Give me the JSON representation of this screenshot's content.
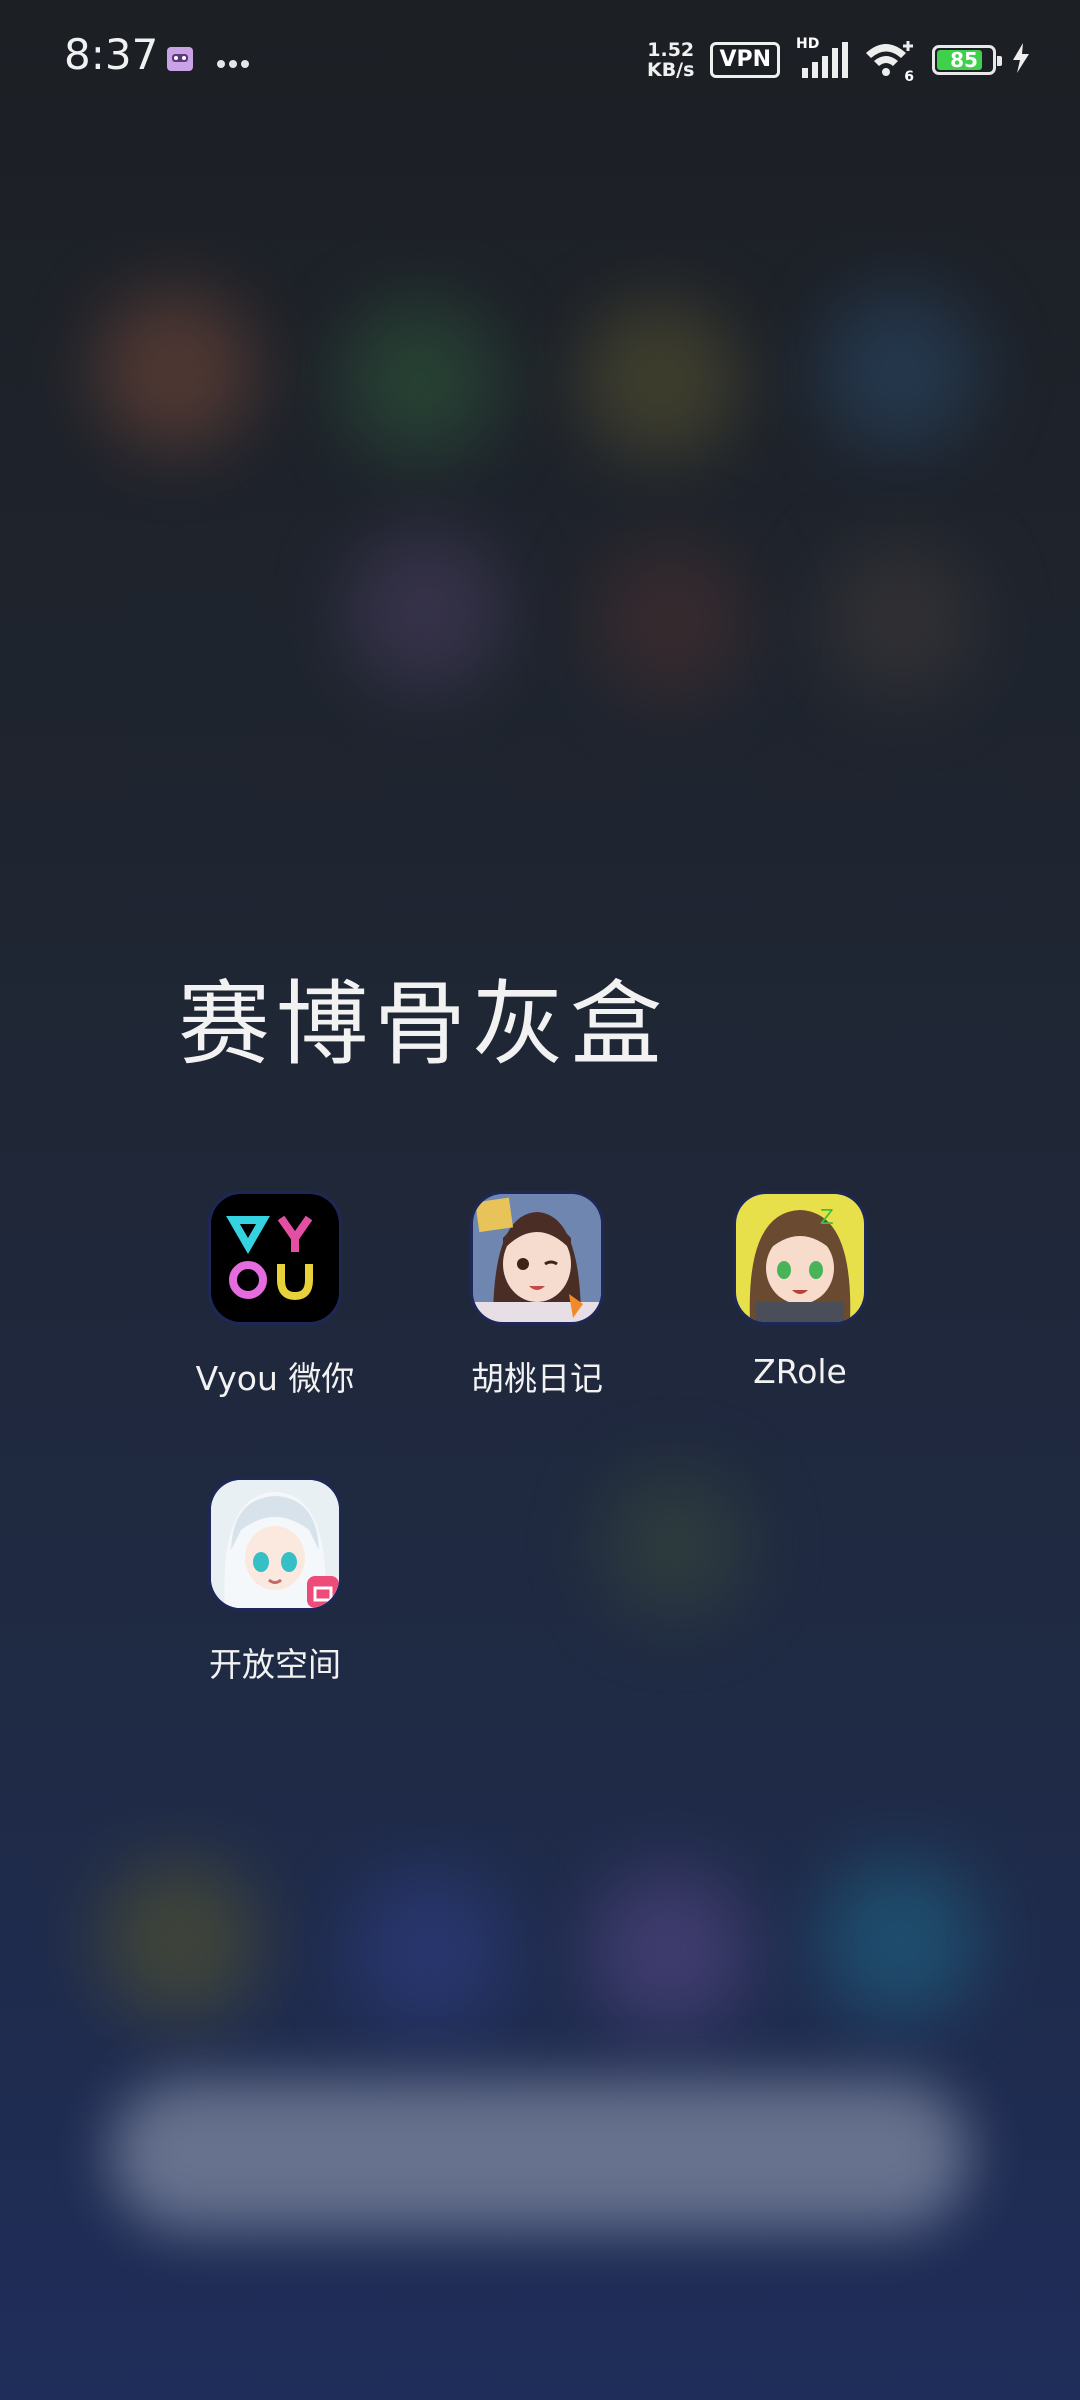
{
  "status_bar": {
    "time": "8:37",
    "net_speed_value": "1.52",
    "net_speed_unit": "KB/s",
    "vpn_label": "VPN",
    "hd_label": "HD",
    "wifi_badge": "6",
    "battery_level": "85",
    "icons": [
      "notification-app-icon",
      "more-dots-icon",
      "signal-icon",
      "wifi-icon",
      "battery-icon",
      "charging-icon"
    ]
  },
  "folder": {
    "title": "赛博骨灰盒",
    "apps": [
      {
        "label": "Vyou 微你",
        "icon": "vyou-app-icon"
      },
      {
        "label": "胡桃日记",
        "icon": "hutao-diary-app-icon"
      },
      {
        "label": "ZRole",
        "icon": "zrole-app-icon"
      },
      {
        "label": "开放空间",
        "icon": "open-space-app-icon"
      }
    ]
  },
  "colors": {
    "background_top": "#1c1f24",
    "background_bottom": "#1f2d5a",
    "battery_fill": "#3fd14a"
  }
}
